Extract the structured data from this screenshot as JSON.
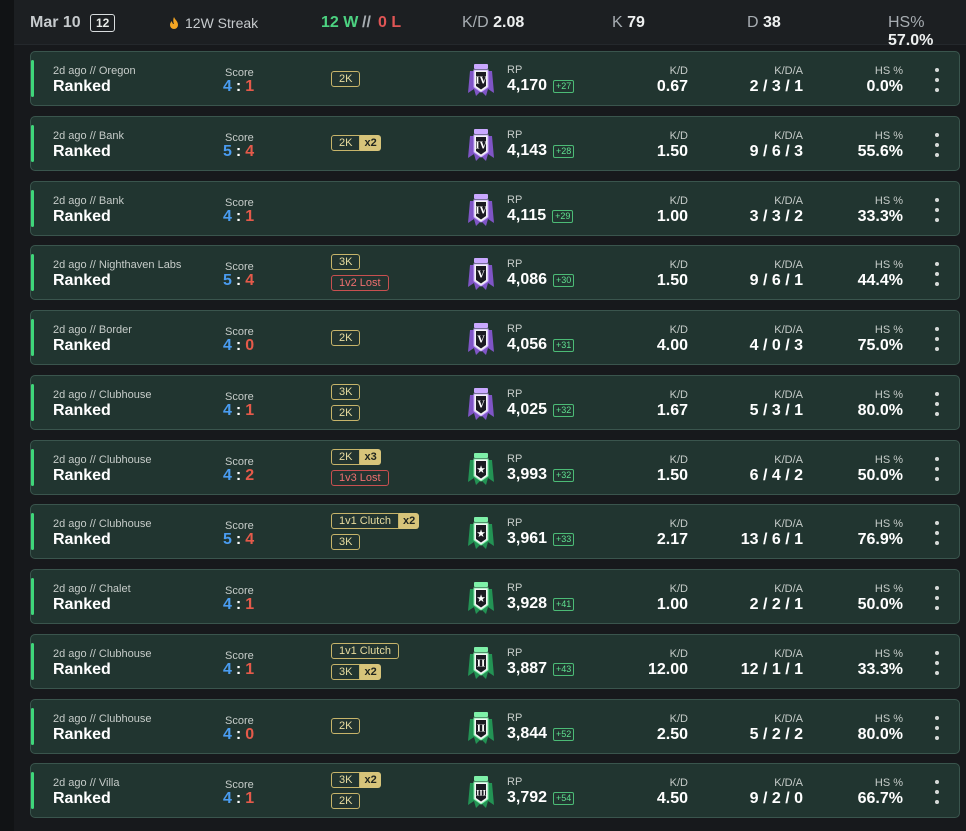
{
  "header": {
    "date": "Mar 10",
    "match_count": "12",
    "streak": "12W Streak",
    "wins": "12 W",
    "separator": "//",
    "losses": "0 L",
    "kd_label": "K/D",
    "kd_value": "2.08",
    "k_label": "K",
    "k_value": "79",
    "d_label": "D",
    "d_value": "38",
    "hs_label": "HS%",
    "hs_value": "57.0%"
  },
  "labels": {
    "score": "Score",
    "rp": "RP",
    "kd": "K/D",
    "kda": "K/D/A",
    "hs": "HS %"
  },
  "colors": {
    "win_accent": "#3fd67a",
    "team_score": "#4a9cf0",
    "enemy_score": "#e55a4a",
    "badge": "#d7c47a",
    "rp_gain": "#5fe08f",
    "amethyst_rank": "#8f5be0",
    "emerald_rank": "#23a35a"
  },
  "matches": [
    {
      "meta": "2d ago // Oregon",
      "mode": "Ranked",
      "score_w": "4",
      "score_l": "1",
      "badges": [
        {
          "text": "2K",
          "mult": "",
          "lost": false
        }
      ],
      "rank_icon": "amethyst-rank-icon",
      "rank_tier": "IV",
      "rp": "4,170",
      "rp_gain": "+27",
      "kd": "0.67",
      "kda": "2 / 3 / 1",
      "hs": "0.0%"
    },
    {
      "meta": "2d ago // Bank",
      "mode": "Ranked",
      "score_w": "5",
      "score_l": "4",
      "badges": [
        {
          "text": "2K",
          "mult": "x2",
          "lost": false
        }
      ],
      "rank_icon": "amethyst-rank-icon",
      "rank_tier": "IV",
      "rp": "4,143",
      "rp_gain": "+28",
      "kd": "1.50",
      "kda": "9 / 6 / 3",
      "hs": "55.6%"
    },
    {
      "meta": "2d ago // Bank",
      "mode": "Ranked",
      "score_w": "4",
      "score_l": "1",
      "badges": [],
      "rank_icon": "amethyst-rank-icon",
      "rank_tier": "IV",
      "rp": "4,115",
      "rp_gain": "+29",
      "kd": "1.00",
      "kda": "3 / 3 / 2",
      "hs": "33.3%"
    },
    {
      "meta": "2d ago // Nighthaven Labs",
      "mode": "Ranked",
      "score_w": "5",
      "score_l": "4",
      "badges": [
        {
          "text": "3K",
          "mult": "",
          "lost": false
        },
        {
          "text": "1v2 Lost",
          "mult": "",
          "lost": true
        }
      ],
      "rank_icon": "amethyst-rank-icon",
      "rank_tier": "V",
      "rp": "4,086",
      "rp_gain": "+30",
      "kd": "1.50",
      "kda": "9 / 6 / 1",
      "hs": "44.4%"
    },
    {
      "meta": "2d ago // Border",
      "mode": "Ranked",
      "score_w": "4",
      "score_l": "0",
      "badges": [
        {
          "text": "2K",
          "mult": "",
          "lost": false
        }
      ],
      "rank_icon": "amethyst-rank-icon",
      "rank_tier": "V",
      "rp": "4,056",
      "rp_gain": "+31",
      "kd": "4.00",
      "kda": "4 / 0 / 3",
      "hs": "75.0%"
    },
    {
      "meta": "2d ago // Clubhouse",
      "mode": "Ranked",
      "score_w": "4",
      "score_l": "1",
      "badges": [
        {
          "text": "3K",
          "mult": "",
          "lost": false
        },
        {
          "text": "2K",
          "mult": "",
          "lost": false
        }
      ],
      "rank_icon": "amethyst-rank-icon",
      "rank_tier": "V",
      "rp": "4,025",
      "rp_gain": "+32",
      "kd": "1.67",
      "kda": "5 / 3 / 1",
      "hs": "80.0%"
    },
    {
      "meta": "2d ago // Clubhouse",
      "mode": "Ranked",
      "score_w": "4",
      "score_l": "2",
      "badges": [
        {
          "text": "2K",
          "mult": "x3",
          "lost": false
        },
        {
          "text": "1v3 Lost",
          "mult": "",
          "lost": true
        }
      ],
      "rank_icon": "emerald-rank-icon",
      "rank_tier": "★",
      "rp": "3,993",
      "rp_gain": "+32",
      "kd": "1.50",
      "kda": "6 / 4 / 2",
      "hs": "50.0%"
    },
    {
      "meta": "2d ago // Clubhouse",
      "mode": "Ranked",
      "score_w": "5",
      "score_l": "4",
      "badges": [
        {
          "text": "1v1 Clutch",
          "mult": "x2",
          "lost": false
        },
        {
          "text": "3K",
          "mult": "",
          "lost": false
        }
      ],
      "rank_icon": "emerald-rank-icon",
      "rank_tier": "★",
      "rp": "3,961",
      "rp_gain": "+33",
      "kd": "2.17",
      "kda": "13 / 6 / 1",
      "hs": "76.9%"
    },
    {
      "meta": "2d ago // Chalet",
      "mode": "Ranked",
      "score_w": "4",
      "score_l": "1",
      "badges": [],
      "rank_icon": "emerald-rank-icon",
      "rank_tier": "★",
      "rp": "3,928",
      "rp_gain": "+41",
      "kd": "1.00",
      "kda": "2 / 2 / 1",
      "hs": "50.0%"
    },
    {
      "meta": "2d ago // Clubhouse",
      "mode": "Ranked",
      "score_w": "4",
      "score_l": "1",
      "badges": [
        {
          "text": "1v1 Clutch",
          "mult": "",
          "lost": false
        },
        {
          "text": "3K",
          "mult": "x2",
          "lost": false
        }
      ],
      "rank_icon": "emerald-rank-icon",
      "rank_tier": "II",
      "rp": "3,887",
      "rp_gain": "+43",
      "kd": "12.00",
      "kda": "12 / 1 / 1",
      "hs": "33.3%"
    },
    {
      "meta": "2d ago // Clubhouse",
      "mode": "Ranked",
      "score_w": "4",
      "score_l": "0",
      "badges": [
        {
          "text": "2K",
          "mult": "",
          "lost": false
        }
      ],
      "rank_icon": "emerald-rank-icon",
      "rank_tier": "II",
      "rp": "3,844",
      "rp_gain": "+52",
      "kd": "2.50",
      "kda": "5 / 2 / 2",
      "hs": "80.0%"
    },
    {
      "meta": "2d ago // Villa",
      "mode": "Ranked",
      "score_w": "4",
      "score_l": "1",
      "badges": [
        {
          "text": "3K",
          "mult": "x2",
          "lost": false
        },
        {
          "text": "2K",
          "mult": "",
          "lost": false
        }
      ],
      "rank_icon": "emerald-rank-icon",
      "rank_tier": "III",
      "rp": "3,792",
      "rp_gain": "+54",
      "kd": "4.50",
      "kda": "9 / 2 / 0",
      "hs": "66.7%"
    }
  ]
}
